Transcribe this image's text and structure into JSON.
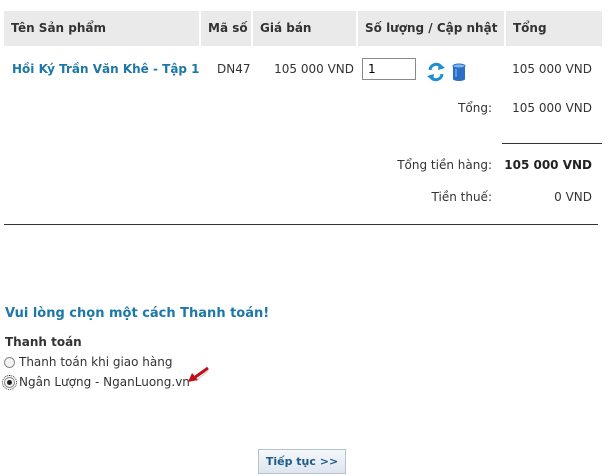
{
  "cart": {
    "headers": {
      "product": "Tên Sản phẩm",
      "code": "Mã số",
      "price": "Giá bán",
      "qty_update": "Số lượng / Cập nhật",
      "total": "Tổng"
    },
    "item": {
      "name": "Hồi Ký Trần Văn Khê - Tập 1",
      "code": "DN47",
      "price": "105 000 VND",
      "quantity": "1",
      "total": "105 000 VND"
    },
    "subtotal_label": "Tổng:",
    "subtotal_value": "105 000 VND",
    "grand_total_label": "Tổng tiền hàng:",
    "grand_total_value": "105 000 VND",
    "tax_label": "Tiền thuế:",
    "tax_value": "0 VND"
  },
  "payment": {
    "title": "Vui lòng chọn một cách Thanh toán!",
    "section_label": "Thanh toán",
    "options": [
      {
        "label": "Thanh toán khi giao hàng",
        "selected": false
      },
      {
        "label": "Ngân Lượng - NganLuong.vn",
        "selected": true
      }
    ]
  },
  "continue_button": "Tiếp tục >>",
  "colors": {
    "link": "#1c78a6",
    "header_bg": "#eaeaea",
    "arrow": "#c0101a"
  },
  "icons": [
    "refresh-icon",
    "database-icon",
    "arrow-pointer-icon"
  ]
}
